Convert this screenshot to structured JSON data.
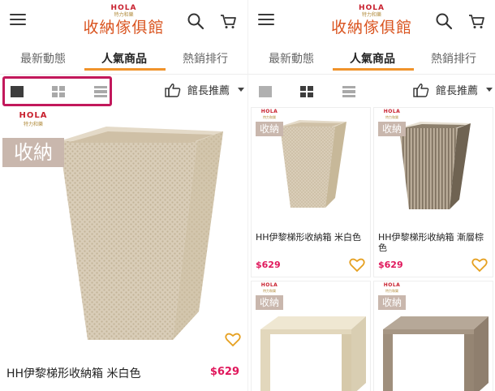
{
  "app": {
    "logo_brand": "HOLA",
    "logo_sub": "特力和樂",
    "logo_name": "收納傢俱館"
  },
  "tabs": [
    "最新動態",
    "人氣商品",
    "熱銷排行"
  ],
  "active_tab": 1,
  "view_modes": [
    "single",
    "grid",
    "list"
  ],
  "sort": {
    "label": "館長推薦"
  },
  "category_badge": "收納",
  "screens": [
    {
      "mode": "single",
      "products": [
        {
          "title": "HH伊黎梯形收納箱 米白色",
          "price": "$629",
          "color": "beige"
        }
      ]
    },
    {
      "mode": "grid",
      "products": [
        {
          "title": "HH伊黎梯形收納箱 米白色",
          "price": "$629",
          "color": "beige"
        },
        {
          "title": "HH伊黎梯形收納箱 漸層棕色",
          "price": "$629",
          "color": "brown"
        },
        {
          "title": "",
          "price": "",
          "color": "cream-shelf"
        },
        {
          "title": "",
          "price": "",
          "color": "taupe-shelf"
        }
      ]
    }
  ],
  "colors": {
    "accent": "#f0932b",
    "price": "#e0185c",
    "highlight": "#c2185b",
    "logo_text": "#d9531e",
    "badge_bg": "#c9b7ad"
  }
}
